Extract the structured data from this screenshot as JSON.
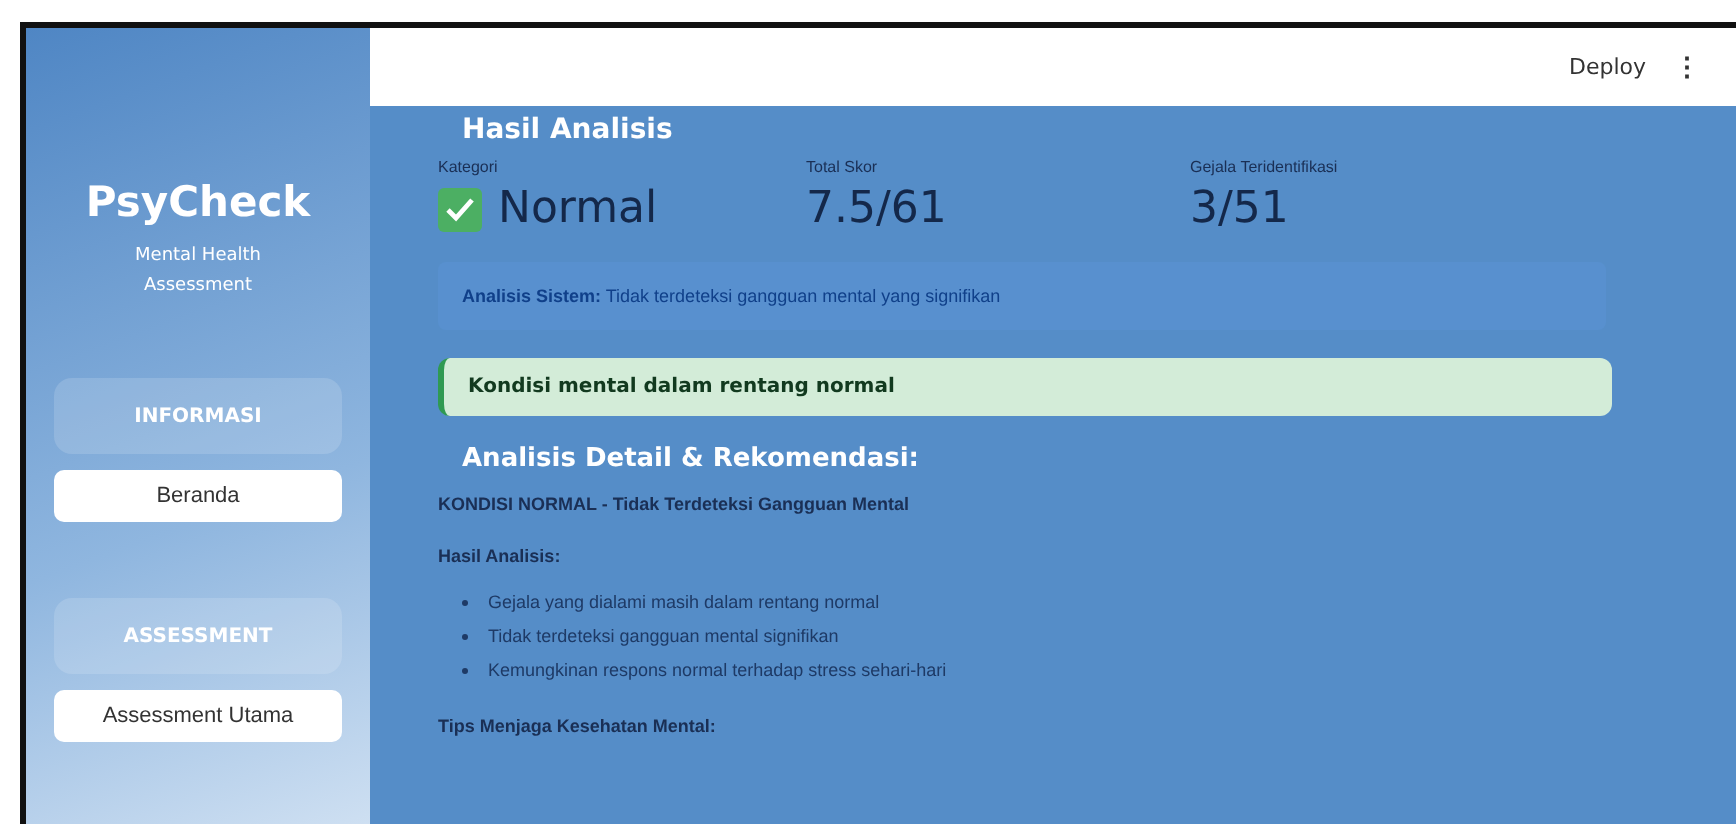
{
  "sidebar": {
    "title": "PsyCheck",
    "subtitle": "Mental Health Assessment",
    "sections": [
      {
        "heading": "INFORMASI",
        "items": [
          {
            "label": "Beranda"
          }
        ]
      },
      {
        "heading": "ASSESSMENT",
        "items": [
          {
            "label": "Assessment Utama"
          }
        ]
      }
    ]
  },
  "topbar": {
    "deploy": "Deploy",
    "menu": "⋮"
  },
  "main": {
    "title": "Hasil Analisis",
    "metrics": [
      {
        "label": "Kategori",
        "value": "Normal",
        "kind": "category"
      },
      {
        "label": "Total Skor",
        "value": "7.5/61",
        "kind": "score"
      },
      {
        "label": "Gejala Teridentifikasi",
        "value": "3/51",
        "kind": "score"
      }
    ],
    "info": {
      "label": "Analisis Sistem:",
      "text": "Tidak terdeteksi gangguan mental yang signifikan"
    },
    "success": "Kondisi mental dalam rentang normal",
    "detail_title": "Analisis Detail & Rekomendasi:",
    "status": "KONDISI NORMAL - Tidak Terdeteksi Gangguan Mental",
    "result_heading": "Hasil Analisis:",
    "bullets": [
      "Gejala yang dialami masih dalam rentang normal",
      "Tidak terdeteksi gangguan mental signifikan",
      "Kemungkinan respons normal terhadap stress sehari-hari"
    ],
    "tips_heading": "Tips Menjaga Kesehatan Mental:"
  }
}
